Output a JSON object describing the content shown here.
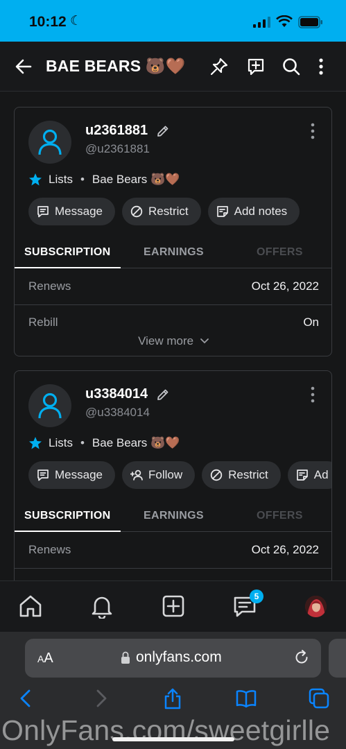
{
  "status_bar": {
    "time": "10:12",
    "moon_glyph": "☾"
  },
  "header": {
    "title": "BAE BEARS 🐻🤎",
    "icons": [
      "back-arrow-icon",
      "pin-icon",
      "add-post-icon",
      "search-icon",
      "more-vertical-icon"
    ]
  },
  "cards": [
    {
      "username": "u2361881",
      "handle": "@u2361881",
      "lists_label": "Lists",
      "list_name": "Bae Bears 🐻🤎",
      "actions": [
        "Message",
        "Restrict",
        "Add notes"
      ],
      "tabs": [
        "SUBSCRIPTION",
        "EARNINGS",
        "OFFERS"
      ],
      "rows": [
        {
          "key": "Renews",
          "value": "Oct 26, 2022"
        },
        {
          "key": "Rebill",
          "value": "On"
        }
      ],
      "view_more": "View more"
    },
    {
      "username": "u3384014",
      "handle": "@u3384014",
      "lists_label": "Lists",
      "list_name": "Bae Bears 🐻🤎",
      "actions": [
        "Message",
        "Follow",
        "Restrict",
        "Ad"
      ],
      "tabs": [
        "SUBSCRIPTION",
        "EARNINGS",
        "OFFERS"
      ],
      "rows": [
        {
          "key": "Renews",
          "value": "Oct 26, 2022"
        }
      ]
    }
  ],
  "bottom_nav": {
    "items": [
      "home-icon",
      "notifications-icon",
      "new-post-icon",
      "messages-icon",
      "profile-avatar"
    ],
    "messages_badge": "5"
  },
  "safari": {
    "aa_small": "A",
    "aa_large": "A",
    "domain": "onlyfans.com"
  },
  "watermark": "OnlyFans.com/sweetgirlle",
  "colors": {
    "accent": "#00aff0",
    "background": "#18191b",
    "pill": "#2c2e31",
    "border": "#3a3c40"
  }
}
